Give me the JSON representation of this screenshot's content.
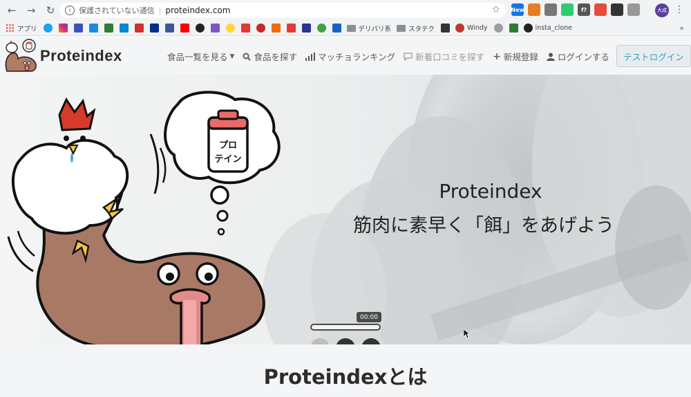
{
  "browser": {
    "address_insecure_label": "保護されていない通信",
    "url": "proteindex.com",
    "avatar_initials": "大成",
    "bookmarks": [
      {
        "label": "アプリ",
        "color": "#e44"
      },
      {
        "label": "デリバリ系",
        "folder": true
      },
      {
        "label": "スタテク",
        "folder": true
      },
      {
        "label": "Windy",
        "color": "#c0392b"
      },
      {
        "label": "insta_clone",
        "color": "#222"
      }
    ],
    "extensions": [
      {
        "name": "new-ext-icon",
        "color": "#1a73e8",
        "text": "New"
      },
      {
        "name": "pumpkin-ext-icon",
        "color": "#e67e22",
        "text": ""
      },
      {
        "name": "puzzle-ext-icon",
        "color": "#777",
        "text": ""
      },
      {
        "name": "color-ext-icon",
        "color": "#2ecc71",
        "text": ""
      },
      {
        "name": "function-ext-icon",
        "color": "#555",
        "text": "f?"
      },
      {
        "name": "people-ext-icon",
        "color": "#e74c3c",
        "text": ""
      },
      {
        "name": "screen-ext-icon",
        "color": "#333",
        "text": ""
      },
      {
        "name": "edit-ext-icon",
        "color": "#999",
        "text": ""
      }
    ]
  },
  "site": {
    "logo_text": "Proteindex",
    "nav": [
      {
        "label": "食品一覧を見る",
        "icon": "caret-down-icon",
        "muted": false
      },
      {
        "label": "食品を探す",
        "icon": "search-icon",
        "muted": false
      },
      {
        "label": "マッチョランキング",
        "icon": "bar-chart-icon",
        "muted": false
      },
      {
        "label": "新着口コミを探す",
        "icon": "comment-icon",
        "muted": true
      },
      {
        "label": "新規登録",
        "icon": "plus-icon",
        "muted": false
      },
      {
        "label": "ログインする",
        "icon": "user-icon",
        "muted": false
      }
    ],
    "test_login_label": "テストログイン"
  },
  "hero": {
    "title": "Proteindex",
    "subtitle": "筋肉に素早く「餌」をあげよう",
    "bubble_text_line1": "プロ",
    "bubble_text_line2": "テイン"
  },
  "media": {
    "timer": "00:00"
  },
  "about": {
    "title": "Proteindexとは"
  }
}
